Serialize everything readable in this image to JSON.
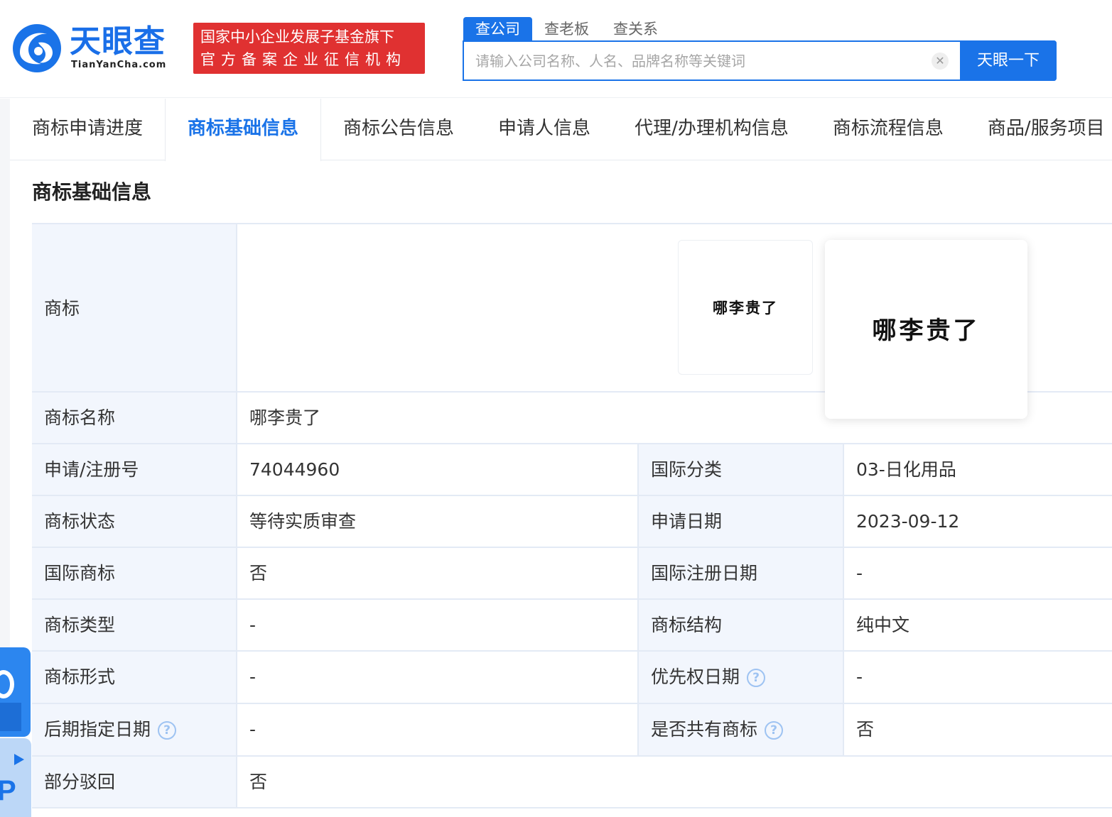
{
  "header": {
    "logo_cn": "天眼查",
    "logo_en": "TianYanCha.com",
    "badge_line1": "国家中小企业发展子基金旗下",
    "badge_line2": "官方备案企业征信机构",
    "colors": {
      "brand": "#1a73e8",
      "badge": "#e03131"
    }
  },
  "search": {
    "tabs": [
      "查公司",
      "查老板",
      "查关系"
    ],
    "active_tab": "查公司",
    "placeholder": "请输入公司名称、人名、品牌名称等关键词",
    "clear_icon": "close-icon",
    "button_label": "天眼一下"
  },
  "nav_tabs": [
    "商标申请进度",
    "商标基础信息",
    "商标公告信息",
    "申请人信息",
    "代理/办理机构信息",
    "商标流程信息",
    "商品/服务项目"
  ],
  "active_nav_tab": "商标基础信息",
  "section_title": "商标基础信息",
  "trademark": {
    "label": "商标",
    "image_text": "哪李贵了",
    "name_label": "商标名称",
    "name_value": "哪李贵了"
  },
  "rows": [
    {
      "l1": "申请/注册号",
      "v1": "74044960",
      "l2": "国际分类",
      "v2": "03-日化用品"
    },
    {
      "l1": "商标状态",
      "v1": "等待实质审查",
      "l2": "申请日期",
      "v2": "2023-09-12"
    },
    {
      "l1": "国际商标",
      "v1": "否",
      "l2": "国际注册日期",
      "v2": "-"
    },
    {
      "l1": "商标类型",
      "v1": "-",
      "l2": "商标结构",
      "v2": "纯中文"
    },
    {
      "l1": "商标形式",
      "v1": "-",
      "l2": "优先权日期",
      "v2": "-"
    },
    {
      "l1": "后期指定日期",
      "v1": "-",
      "l2": "是否共有商标",
      "v2": "否"
    }
  ],
  "last_row": {
    "label": "部分驳回",
    "value": "否"
  },
  "help_glyph": "?"
}
